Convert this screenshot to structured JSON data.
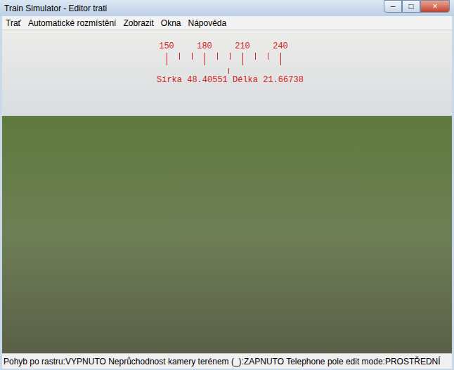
{
  "window": {
    "title": "Train Simulator - Editor trati",
    "controls": [
      "–",
      "□",
      "×"
    ]
  },
  "menu": [
    "Trať",
    "Automatické rozmístění",
    "Zobrazit",
    "Okna",
    "Nápověda"
  ],
  "hud": {
    "compass_labels": [
      "150",
      "180",
      "210",
      "240"
    ],
    "coordinates": "Sírka 48.40551 Délka 21.66738"
  },
  "status_bar": "Pohyb po rastru:VYPNUTO Neprůchodnost kamery terénem (_):ZAPNUTO Telephone pole edit mode:PROSTŘEDNÍ"
}
